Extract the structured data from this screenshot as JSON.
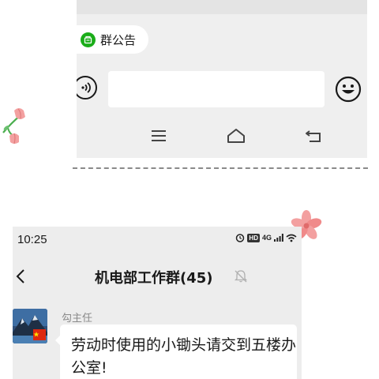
{
  "top_screenshot": {
    "group_notice_label": "群公告",
    "message_input_placeholder": "",
    "icons": {
      "notice": "notice-icon",
      "voice": "voice-icon",
      "emoji": "emoji-icon",
      "menu": "menu-icon",
      "home": "home-icon",
      "back": "back-icon"
    }
  },
  "bottom_screenshot": {
    "status_bar": {
      "time": "10:25",
      "hd_badge": "HD",
      "network": "4G"
    },
    "header": {
      "title": "机电部工作群(45)"
    },
    "message": {
      "sender": "勾主任",
      "text": "劳动时使用的小锄头请交到五楼办公室!"
    }
  },
  "colors": {
    "accent_green": "#1aad19",
    "chat_background": "#ededed",
    "bubble": "#ffffff",
    "flower_pink": "#f08a8a"
  }
}
